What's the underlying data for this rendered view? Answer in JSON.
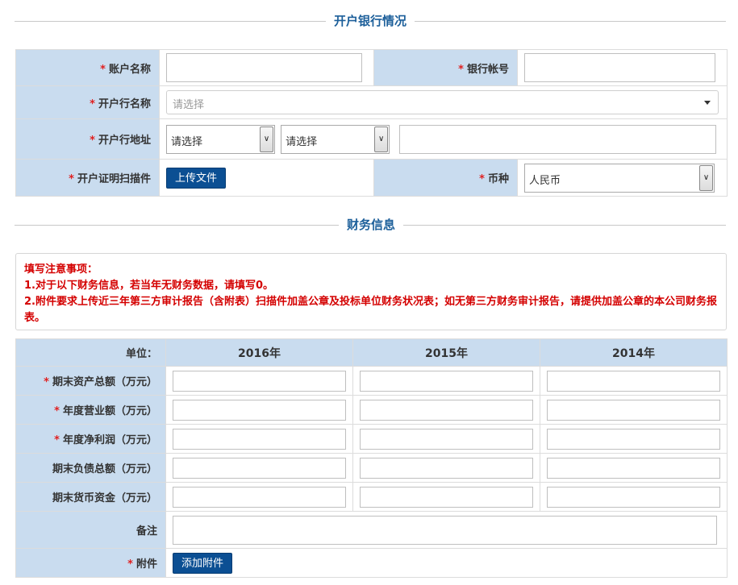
{
  "sections": {
    "bank": "开户银行情况",
    "finance": "财务信息"
  },
  "bank": {
    "account_name_label": "账户名称",
    "account_no_label": "银行帐号",
    "bank_name_label": "开户行名称",
    "bank_name_placeholder": "请选择",
    "bank_addr_label": "开户行地址",
    "province_value": "请选择",
    "city_value": "请选择",
    "scan_label": "开户证明扫描件",
    "upload_button": "上传文件",
    "currency_label": "币种",
    "currency_value": "人民币"
  },
  "notice": {
    "title": "填写注意事项：",
    "line1": "1.对于以下财务信息，若当年无财务数据，请填写0。",
    "line2": "2.附件要求上传近三年第三方审计报告（含附表）扫描件加盖公章及投标单位财务状况表；如无第三方财务审计报告，请提供加盖公章的本公司财务报表。"
  },
  "finance": {
    "unit_label": "单位：",
    "years": [
      "2016年",
      "2015年",
      "2014年"
    ],
    "rows": [
      {
        "label": "期末资产总额（万元）",
        "required": true
      },
      {
        "label": "年度营业额（万元）",
        "required": true
      },
      {
        "label": "年度净利润（万元）",
        "required": true
      },
      {
        "label": "期末负债总额（万元）",
        "required": false
      },
      {
        "label": "期末货币资金（万元）",
        "required": false
      }
    ],
    "remark_label": "备注",
    "attachment_label": "附件",
    "add_attachment_button": "添加附件"
  },
  "colors": {
    "label_bg": "#c9dcef",
    "title": "#1c5f9a",
    "required": "#e02020",
    "button": "#0b4f93",
    "notice": "#d40000"
  }
}
